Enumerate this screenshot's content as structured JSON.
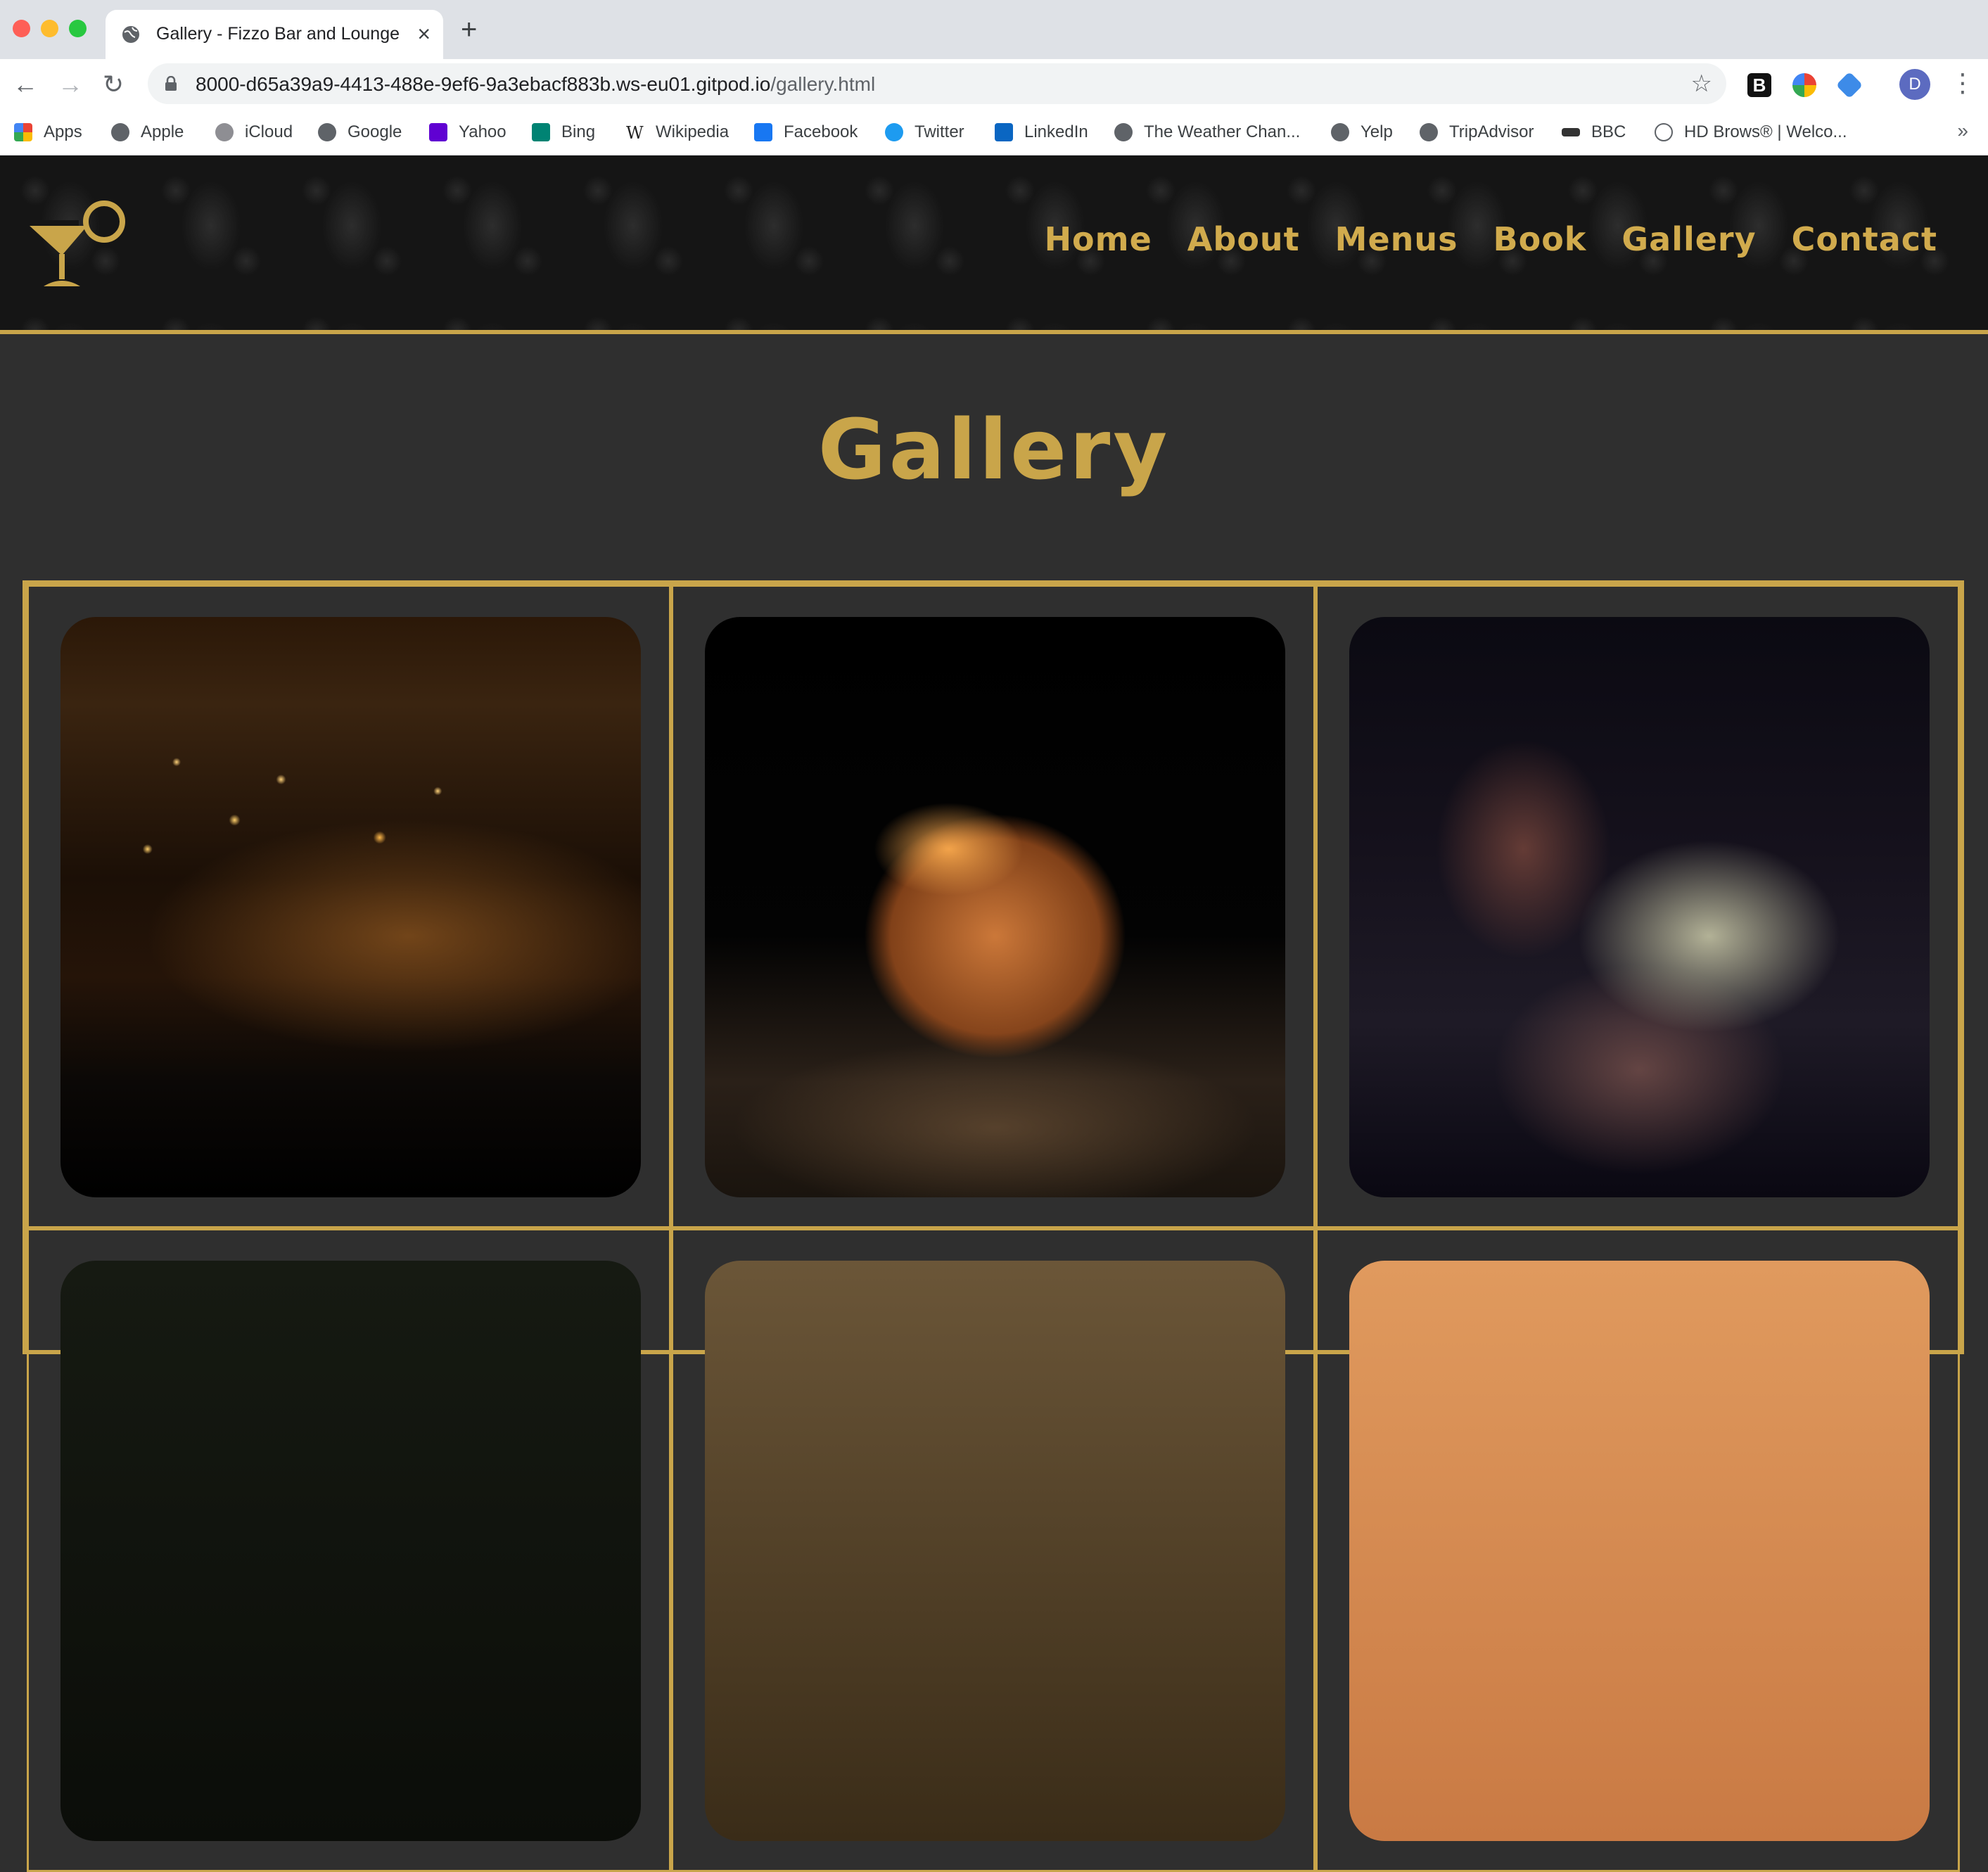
{
  "browser": {
    "tab_title": "Gallery - Fizzo Bar and Lounge",
    "url_host": "8000-d65a39a9-4413-488e-9ef6-9a3ebacf883b.ws-eu01.gitpod.io",
    "url_path": "/gallery.html",
    "profile_initial": "D",
    "bookmarks": [
      {
        "label": "Apps",
        "icon": "apps-grid-icon"
      },
      {
        "label": "Apple",
        "icon": "globe-icon"
      },
      {
        "label": "iCloud",
        "icon": "apple-icon"
      },
      {
        "label": "Google",
        "icon": "globe-icon"
      },
      {
        "label": "Yahoo",
        "icon": "yahoo-icon"
      },
      {
        "label": "Bing",
        "icon": "bing-icon"
      },
      {
        "label": "Wikipedia",
        "icon": "wikipedia-icon"
      },
      {
        "label": "Facebook",
        "icon": "facebook-icon"
      },
      {
        "label": "Twitter",
        "icon": "twitter-icon"
      },
      {
        "label": "LinkedIn",
        "icon": "linkedin-icon"
      },
      {
        "label": "The Weather Chan...",
        "icon": "globe-icon"
      },
      {
        "label": "Yelp",
        "icon": "globe-icon"
      },
      {
        "label": "TripAdvisor",
        "icon": "globe-icon"
      },
      {
        "label": "BBC",
        "icon": "bbc-icon"
      },
      {
        "label": "HD Brows® | Welco...",
        "icon": "hd-brows-icon"
      }
    ]
  },
  "site": {
    "nav": [
      "Home",
      "About",
      "Menus",
      "Book",
      "Gallery",
      "Contact"
    ],
    "page_title": "Gallery",
    "gallery": [
      {
        "name": "gallery-photo-bar-interior"
      },
      {
        "name": "gallery-photo-cocktail"
      },
      {
        "name": "gallery-photo-bartender"
      },
      {
        "name": "gallery-photo-row2-1"
      },
      {
        "name": "gallery-photo-row2-2"
      },
      {
        "name": "gallery-photo-row2-3"
      }
    ]
  },
  "colors": {
    "gold": "#c9a54a",
    "page_bg": "#2f2f2f",
    "header_bg": "#151515"
  }
}
